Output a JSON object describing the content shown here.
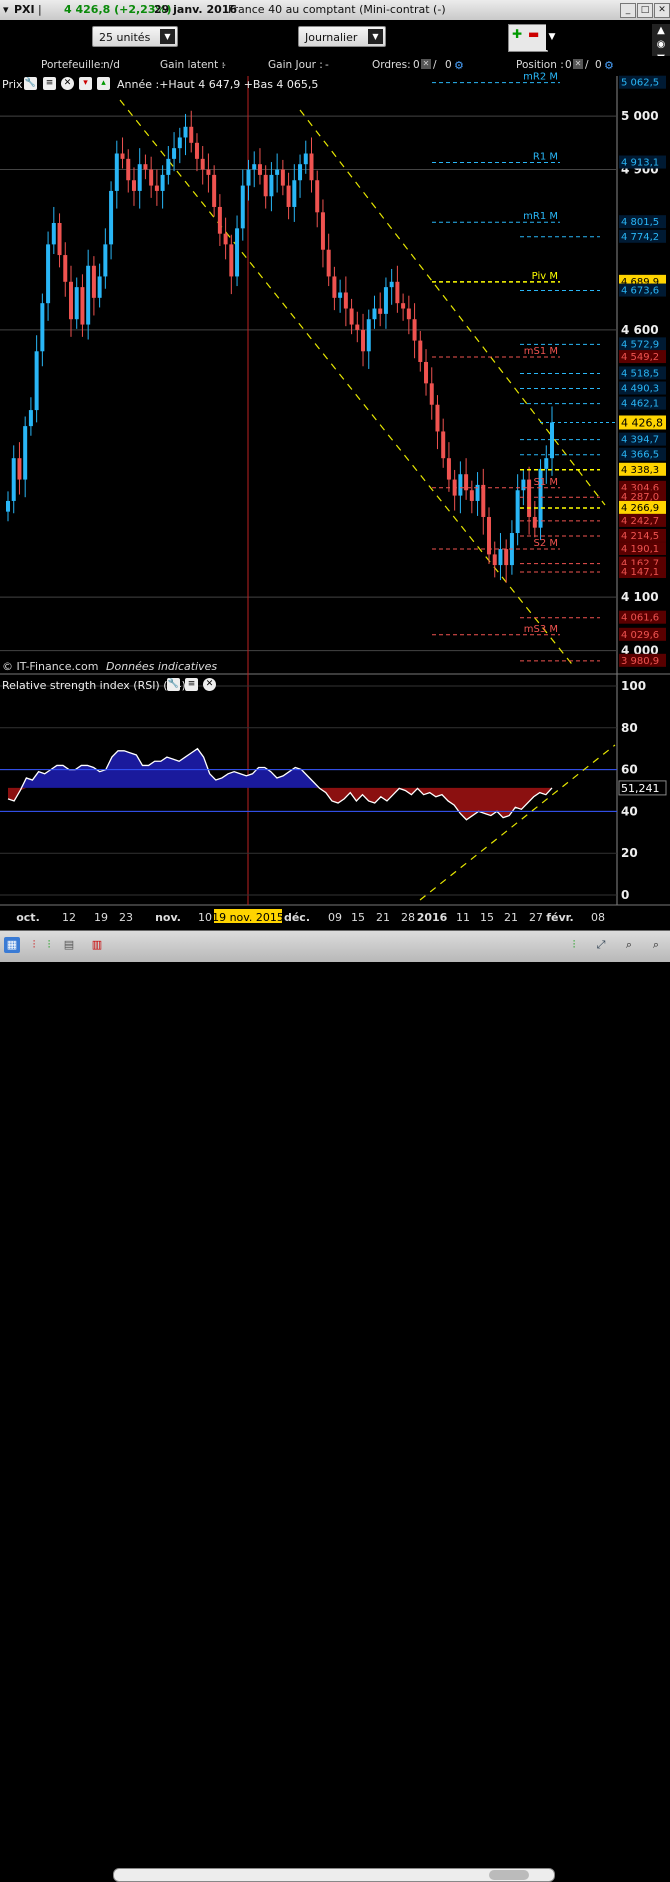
{
  "titlebar": {
    "symbol": "PXI",
    "price_change": "4 426,8 (+2,23%)",
    "date": "29 janv. 2016",
    "instrument": "France 40 au comptant (Mini-contrat (-)"
  },
  "toolbar": {
    "units": "25 unités",
    "period": "Journalier"
  },
  "status": {
    "portefeuille_label": "Portefeuille:",
    "portefeuille_value": "n/d",
    "gain_latent_label": "Gain latent :",
    "gain_latent_value": "-",
    "gain_jour_label": "Gain Jour :",
    "gain_jour_value": "-",
    "ordres_label": "Ordres:",
    "ordres_value": "0",
    "ordres_value2": "0",
    "position_label": "Position :",
    "position_value": "0",
    "position_value2": "0"
  },
  "price_panel": {
    "label": "Prix",
    "annotation": "Année :+Haut 4 647,9 +Bas 4 065,5",
    "credit": "© IT-Finance.com",
    "credit_note": "Données indicatives"
  },
  "rsi_panel": {
    "label": "Relative strength index (RSI) (14)"
  },
  "colors": {
    "up": "#29b6f6",
    "down": "#ef5350",
    "pivot": "#ffff00",
    "rsi_fill_up": "#1a1a9c",
    "rsi_fill_down": "#8b1010",
    "trend": "#e6e600"
  },
  "chart_data": [
    {
      "type": "candlestick",
      "title": "",
      "ylim": [
        3960,
        5075
      ],
      "y_ticks": [
        4000,
        4100,
        4600,
        4900,
        5000
      ],
      "x_ticks": [
        "oct.",
        "12",
        "19",
        "23",
        "nov.",
        "10",
        "19 nov. 2015",
        "déc.",
        "09",
        "15",
        "21",
        "28",
        "2016",
        "11",
        "15",
        "21",
        "27",
        "févr.",
        "08"
      ],
      "highlight_date": "19 nov. 2015",
      "last_close": 4426.8,
      "closes": [
        4280,
        4360,
        4320,
        4420,
        4450,
        4560,
        4650,
        4760,
        4800,
        4740,
        4690,
        4620,
        4680,
        4610,
        4720,
        4660,
        4700,
        4760,
        4860,
        4930,
        4920,
        4880,
        4860,
        4910,
        4900,
        4870,
        4860,
        4890,
        4920,
        4940,
        4960,
        4980,
        4950,
        4920,
        4900,
        4890,
        4830,
        4780,
        4760,
        4700,
        4790,
        4870,
        4900,
        4910,
        4890,
        4850,
        4890,
        4900,
        4870,
        4830,
        4880,
        4910,
        4930,
        4880,
        4820,
        4750,
        4700,
        4660,
        4670,
        4640,
        4610,
        4600,
        4560,
        4620,
        4640,
        4630,
        4680,
        4690,
        4650,
        4640,
        4620,
        4580,
        4540,
        4500,
        4460,
        4410,
        4360,
        4320,
        4290,
        4330,
        4300,
        4280,
        4310,
        4250,
        4180,
        4160,
        4190,
        4160,
        4220,
        4300,
        4320,
        4250,
        4230,
        4340,
        4360,
        4426.8
      ],
      "horizontal_levels": [
        {
          "label": "mR2 M",
          "value": 5062.5,
          "axis_label": "5 062,5",
          "color": "#29b6f6"
        },
        {
          "label": "R1 M",
          "value": 4913.1,
          "axis_label": "4 913,1",
          "color": "#29b6f6"
        },
        {
          "label": "mR1 M",
          "value": 4801.5,
          "axis_label": "4 801,5",
          "color": "#29b6f6"
        },
        {
          "label": "",
          "value": 4774.2,
          "axis_label": "4 774,2",
          "color": "#29b6f6"
        },
        {
          "label": "Piv M",
          "value": 4689.9,
          "axis_label": "4 689,9",
          "color": "#ffff00"
        },
        {
          "label": "",
          "value": 4673.6,
          "axis_label": "4 673,6",
          "color": "#29b6f6"
        },
        {
          "label": "",
          "value": 4572.9,
          "axis_label": "4 572,9",
          "color": "#29b6f6"
        },
        {
          "label": "mS1 M",
          "value": 4549.2,
          "axis_label": "4 549,2",
          "color": "#ef5350"
        },
        {
          "label": "",
          "value": 4518.5,
          "axis_label": "4 518,5",
          "color": "#29b6f6"
        },
        {
          "label": "",
          "value": 4490.3,
          "axis_label": "4 490,3",
          "color": "#29b6f6"
        },
        {
          "label": "",
          "value": 4462.1,
          "axis_label": "4 462,1",
          "color": "#29b6f6"
        },
        {
          "label": "",
          "value": 4394.7,
          "axis_label": "4 394,7",
          "color": "#29b6f6"
        },
        {
          "label": "",
          "value": 4366.5,
          "axis_label": "4 366,5",
          "color": "#29b6f6"
        },
        {
          "label": "",
          "value": 4338.3,
          "axis_label": "4 338,3",
          "color": "#ffff00"
        },
        {
          "label": "S1 M",
          "value": 4304.6,
          "axis_label": "4 304,6",
          "color": "#ef5350"
        },
        {
          "label": "",
          "value": 4287.0,
          "axis_label": "4 287,0",
          "color": "#ef5350"
        },
        {
          "label": "",
          "value": 4266.9,
          "axis_label": "4 266,9",
          "color": "#ffff00"
        },
        {
          "label": "",
          "value": 4242.7,
          "axis_label": "4 242,7",
          "color": "#ef5350"
        },
        {
          "label": "",
          "value": 4214.5,
          "axis_label": "4 214,5",
          "color": "#ef5350"
        },
        {
          "label": "S2 M",
          "value": 4190.0,
          "axis_label": "4 190,1",
          "color": "#ef5350"
        },
        {
          "label": "",
          "value": 4162.7,
          "axis_label": "4 162,7",
          "color": "#ef5350"
        },
        {
          "label": "",
          "value": 4147.1,
          "axis_label": "4 147,1",
          "color": "#ef5350"
        },
        {
          "label": "",
          "value": 4061.6,
          "axis_label": "4 061,6",
          "color": "#ef5350"
        },
        {
          "label": "mS3 M",
          "value": 4029.6,
          "axis_label": "4 029,6",
          "color": "#ef5350"
        },
        {
          "label": "",
          "value": 3980.9,
          "axis_label": "3 980,9",
          "color": "#ef5350"
        }
      ]
    },
    {
      "type": "area",
      "title": "Relative strength index (RSI) (14)",
      "ylim": [
        0,
        100
      ],
      "y_ticks": [
        0,
        20,
        40,
        60,
        80,
        100
      ],
      "level": 51.241,
      "level_label": "51,241",
      "values": [
        46,
        45,
        50,
        56,
        55,
        59,
        58,
        60,
        62,
        62,
        60,
        60,
        62,
        62,
        61,
        59,
        60,
        66,
        69,
        69,
        68,
        67,
        62,
        62,
        64,
        64,
        66,
        65,
        64,
        66,
        68,
        70,
        66,
        58,
        55,
        56,
        58,
        59,
        58,
        57,
        58,
        61,
        61,
        59,
        56,
        57,
        59,
        61,
        60,
        57,
        54,
        51,
        49,
        45,
        44,
        46,
        49,
        45,
        48,
        45,
        44,
        47,
        45,
        48,
        51,
        50,
        48,
        51,
        48,
        49,
        47,
        48,
        45,
        43,
        39,
        36,
        38,
        40,
        39,
        38,
        40,
        37,
        38,
        42,
        41,
        44,
        47,
        49,
        48,
        51.241
      ]
    }
  ]
}
